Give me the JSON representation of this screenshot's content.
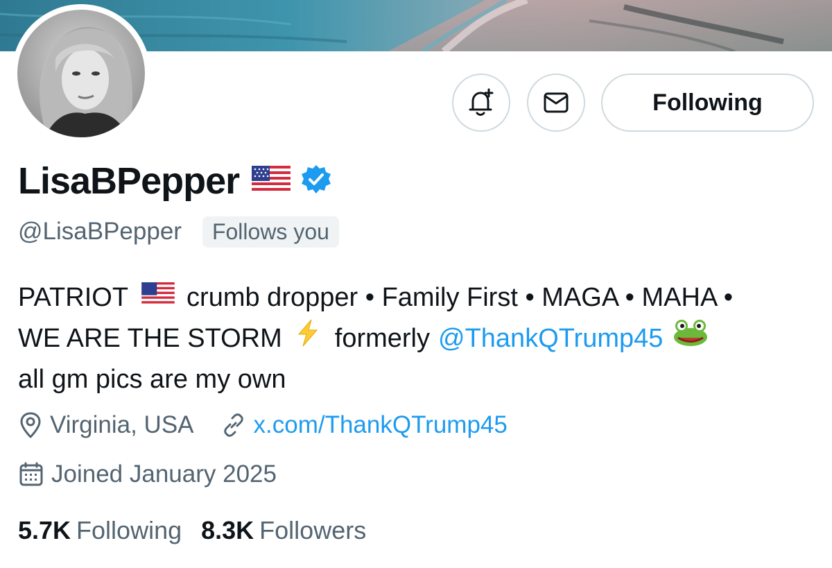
{
  "banner": {
    "icon": "beach-photo"
  },
  "avatar": {
    "icon": "profile-photo"
  },
  "actions": {
    "notify_icon": "bell-plus-icon",
    "message_icon": "envelope-icon",
    "following_label": "Following"
  },
  "profile": {
    "display_name": "LisaBPepper",
    "name_emoji": "🇺🇸",
    "verified": true,
    "handle": "@LisaBPepper",
    "follows_you_label": "Follows you"
  },
  "bio": {
    "line1": {
      "t1": "PATRIOT",
      "t2": "crumb dropper • Family First • MAGA • MAHA •"
    },
    "line2": {
      "t1": "WE ARE THE STORM",
      "t2": "formerly",
      "mention": "@ThankQTrump45"
    },
    "line3": "all gm pics are my own"
  },
  "meta": {
    "location": "Virginia, USA",
    "website": "x.com/ThankQTrump45",
    "joined": "Joined January 2025"
  },
  "stats": {
    "following_count": "5.7K",
    "following_label": "Following",
    "followers_count": "8.3K",
    "followers_label": "Followers"
  },
  "colors": {
    "accent": "#1d9bf0",
    "secondary_text": "#536471",
    "border": "#cfd9de"
  }
}
